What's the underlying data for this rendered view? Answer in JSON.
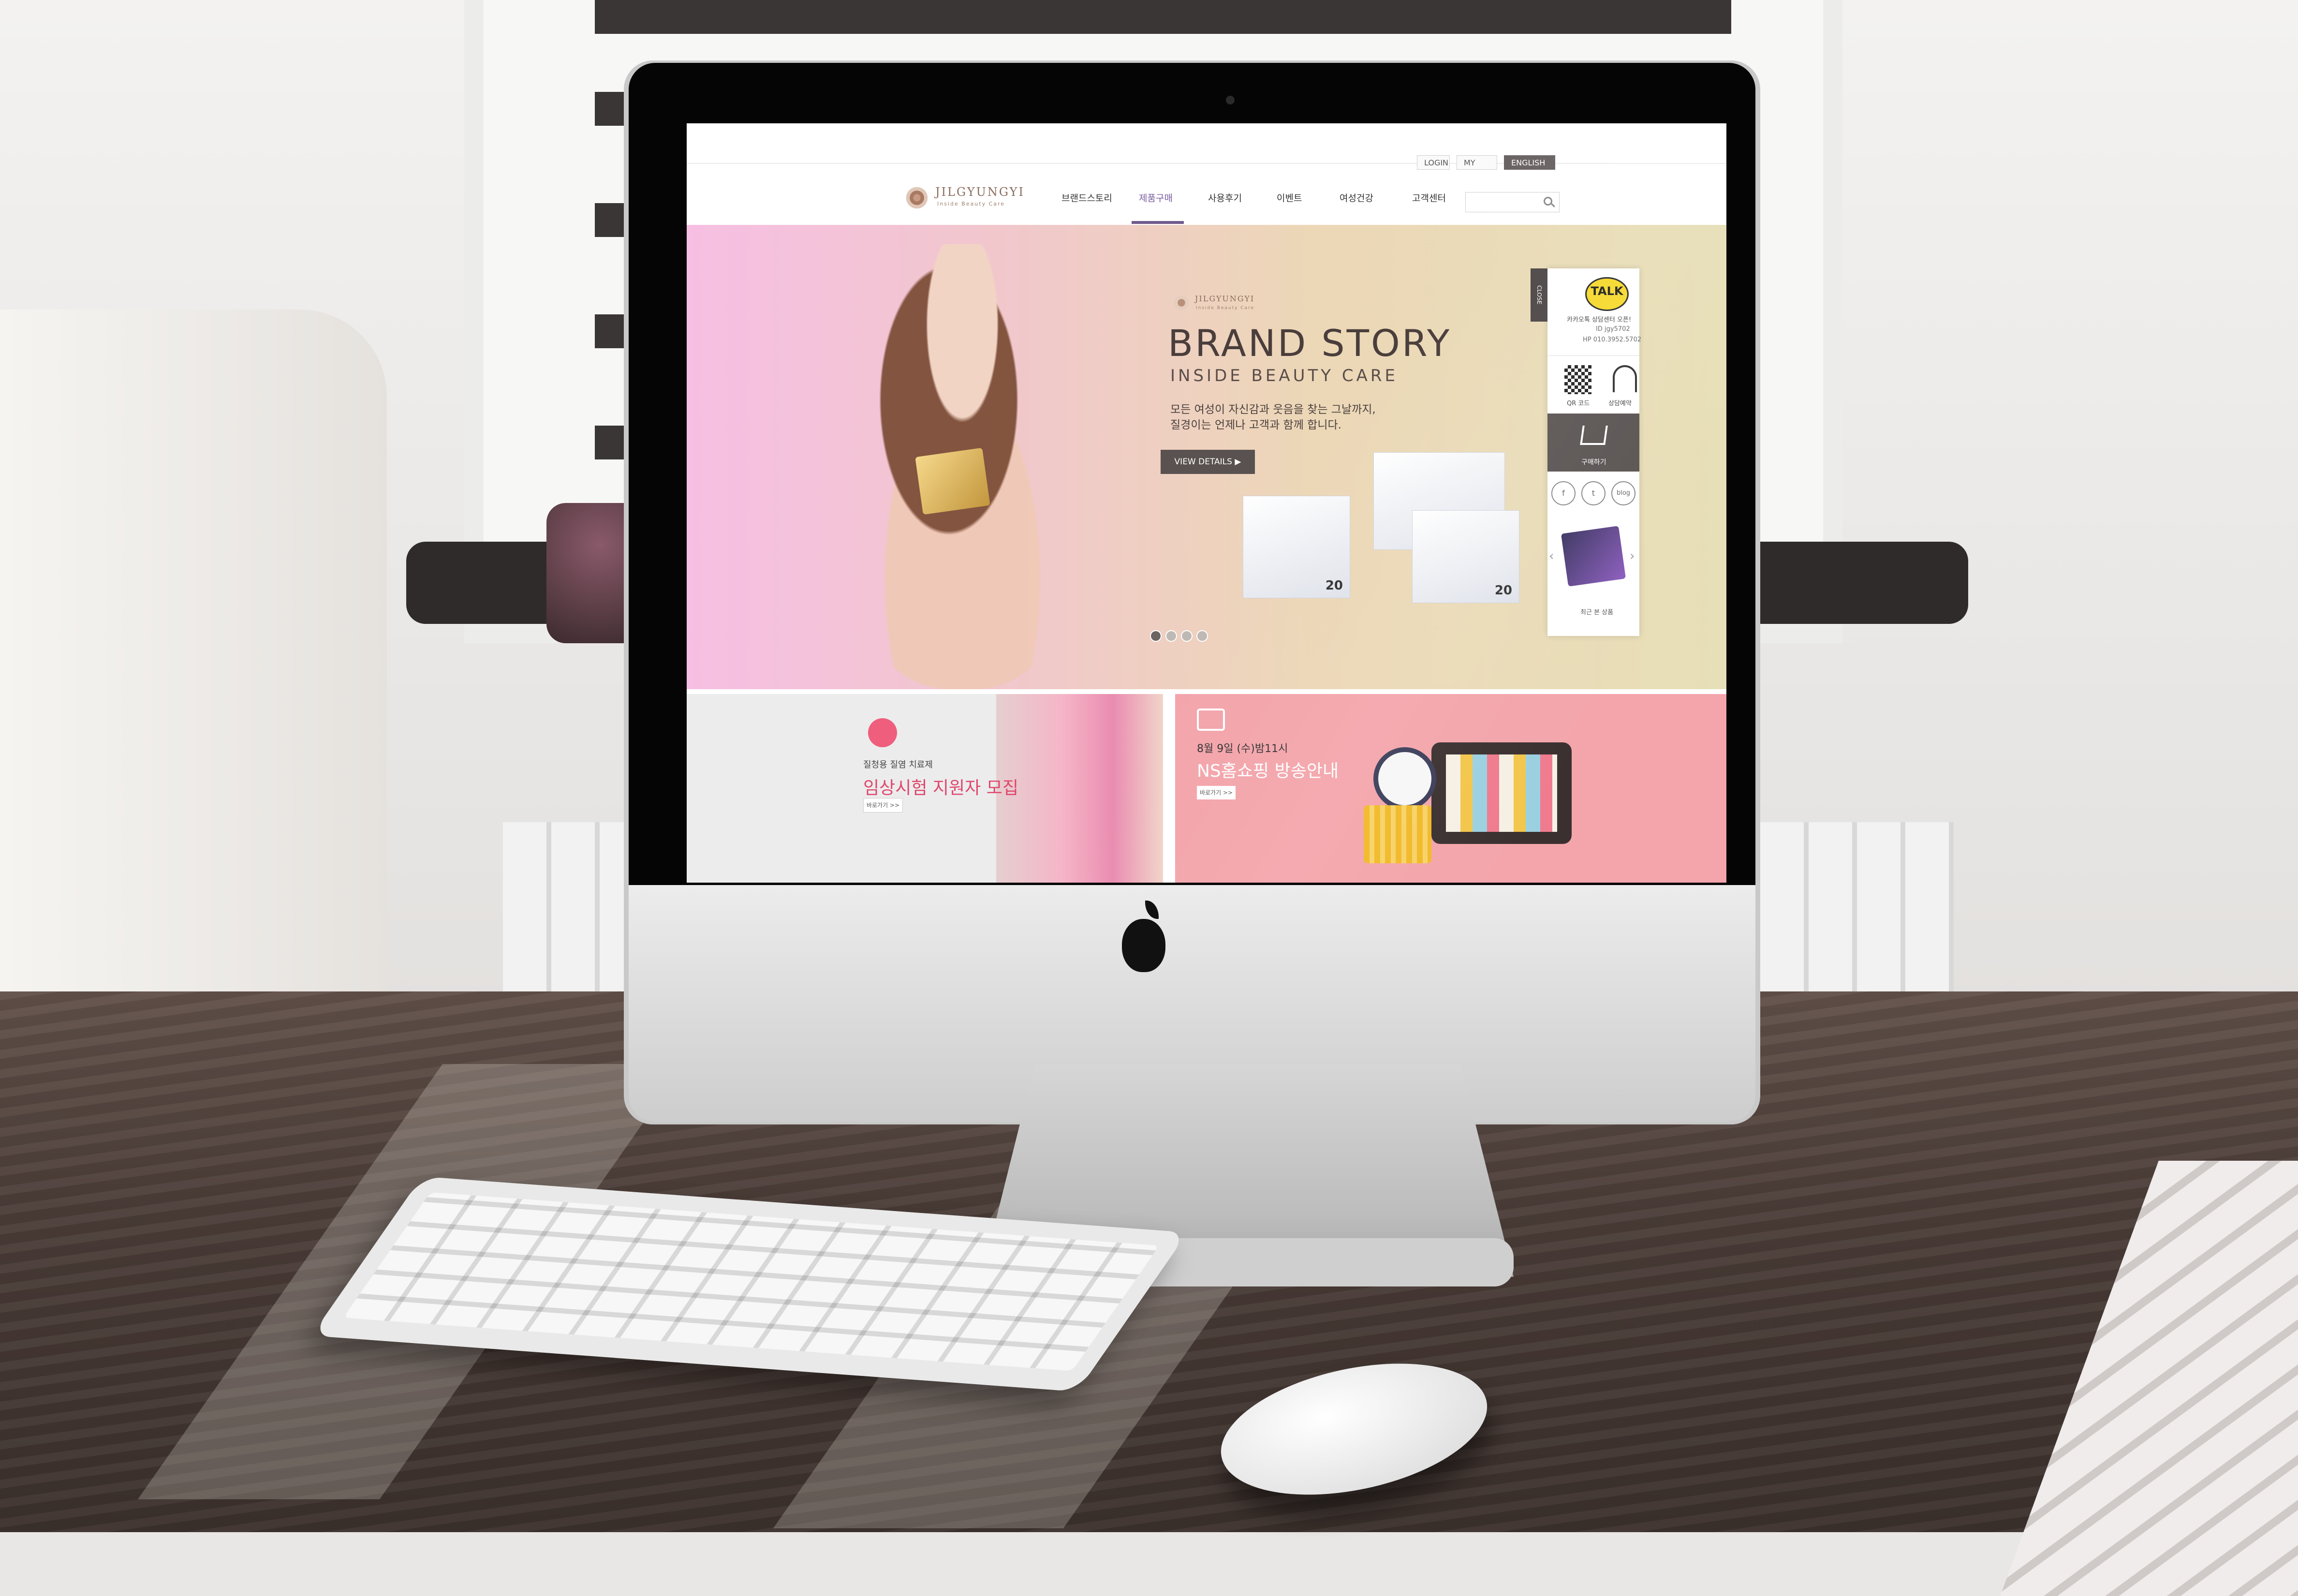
{
  "topbar": {
    "login": "LOGIN",
    "mypage": "MY PAGE",
    "language": "ENGLISH ▼"
  },
  "logo": {
    "wordmark": "JILGYUNGYI",
    "tagline": "Inside Beauty Care"
  },
  "nav": {
    "items": [
      "브랜드스토리",
      "제품구매",
      "사용후기",
      "이벤트",
      "여성건강",
      "고객센터"
    ],
    "active_index": 1
  },
  "search": {
    "placeholder": ""
  },
  "hero": {
    "logo_word": "JILGYUNGYI",
    "logo_sub": "Inside Beauty Care",
    "title": "BRAND STORY",
    "subtitle": "INSIDE BEAUTY CARE",
    "desc_line1": "모든 여성이 자신감과 웃음을 찾는 그날까지,",
    "desc_line2": "질경이는 언제나 고객과 함께 합니다.",
    "button": "VIEW DETAILS  ▶",
    "box_count_label": "20",
    "pager_count": 4,
    "pager_active": 0
  },
  "quick_menu": {
    "close": "CLOSE",
    "talk": "TALK",
    "line1": "카카오톡 상담센터 오픈!",
    "line2": "ID jgy5702",
    "line3": "HP 010.3952.5702",
    "qr_label": "QR 코드",
    "counsel_label": "상담예약",
    "cart_label": "구매하기",
    "social": [
      "f",
      "t",
      "blog"
    ],
    "recent_label": "최근 본 상품",
    "prev_arrow": "‹",
    "next_arrow": "›"
  },
  "banner_left": {
    "small": "질청용 질염 치료제",
    "title": "임상시험 지원자 모집",
    "button": "바로가기 >>"
  },
  "banner_right": {
    "small": "8월 9일 (수)밤11시",
    "title": "NS홈쇼핑 방송안내",
    "button": "바로가기 >>"
  },
  "colors": {
    "accent_purple": "#6f5a8d",
    "pink_banner": "#f3a5ab",
    "dark_button": "#5a5250",
    "kakao_yellow": "#f6d92d"
  }
}
